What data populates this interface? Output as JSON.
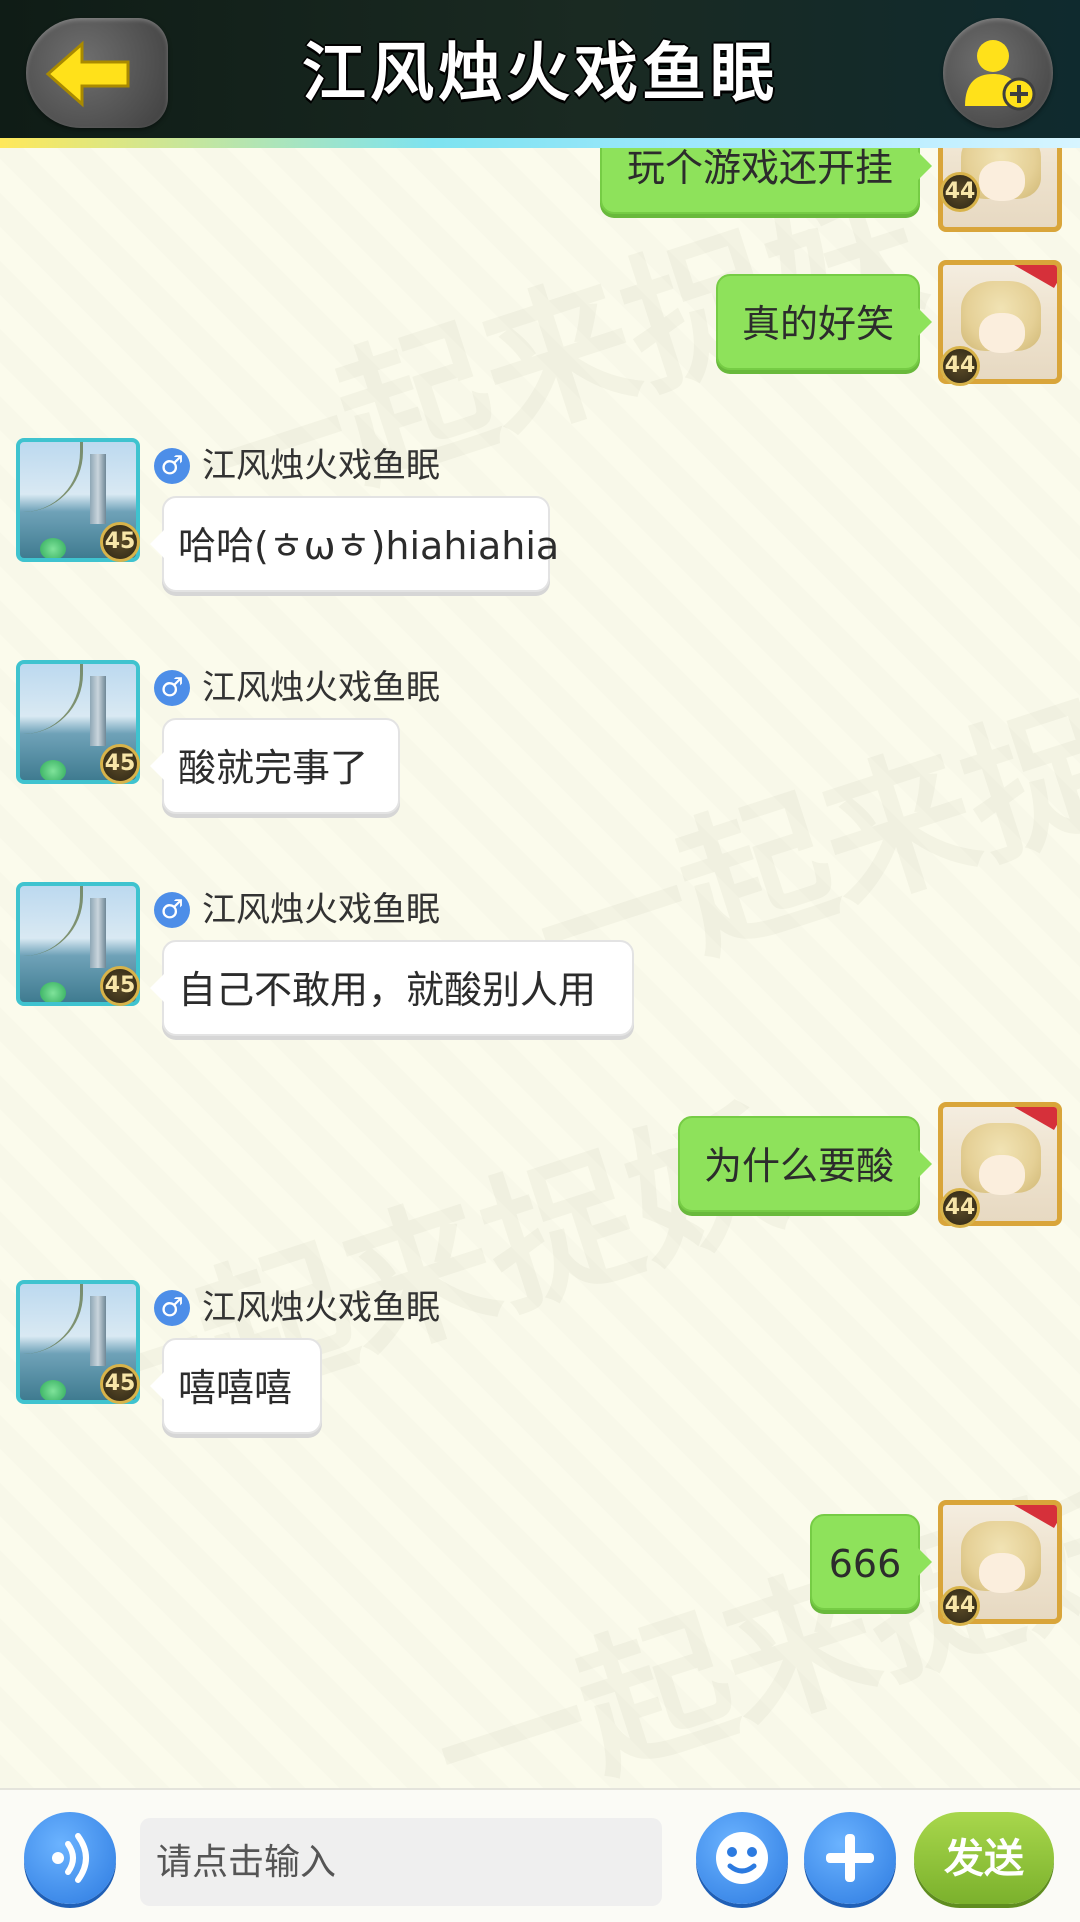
{
  "header": {
    "title": "江风烛火戏鱼眠",
    "back_icon": "back-arrow-icon",
    "add_friend_icon": "add-friend-icon"
  },
  "colors": {
    "header_bg": "#0f1c16",
    "my_bubble": "#8ee25b",
    "their_bubble": "#ffffff",
    "send_button": "#8fc33a",
    "icon_button": "#2c7ae0"
  },
  "messages": [
    {
      "side": "right",
      "text": "玩个游戏还开挂",
      "level": "44"
    },
    {
      "side": "right",
      "text": "真的好笑",
      "level": "44"
    },
    {
      "side": "left",
      "sender": "江风烛火戏鱼眠",
      "gender": "♂",
      "text": "哈哈(ㅎωㅎ)hiahiahia",
      "level": "45"
    },
    {
      "side": "left",
      "sender": "江风烛火戏鱼眠",
      "gender": "♂",
      "text": "酸就完事了",
      "level": "45"
    },
    {
      "side": "left",
      "sender": "江风烛火戏鱼眠",
      "gender": "♂",
      "text": "自己不敢用，就酸别人用",
      "level": "45"
    },
    {
      "side": "right",
      "text": "为什么要酸",
      "level": "44"
    },
    {
      "side": "left",
      "sender": "江风烛火戏鱼眠",
      "gender": "♂",
      "text": "嘻嘻嘻",
      "level": "45"
    },
    {
      "side": "right",
      "text": "666",
      "level": "44"
    }
  ],
  "input_bar": {
    "placeholder": "请点击输入",
    "send_label": "发送",
    "voice_icon": "voice-icon",
    "emoji_icon": "emoji-icon",
    "plus_icon": "plus-icon"
  }
}
